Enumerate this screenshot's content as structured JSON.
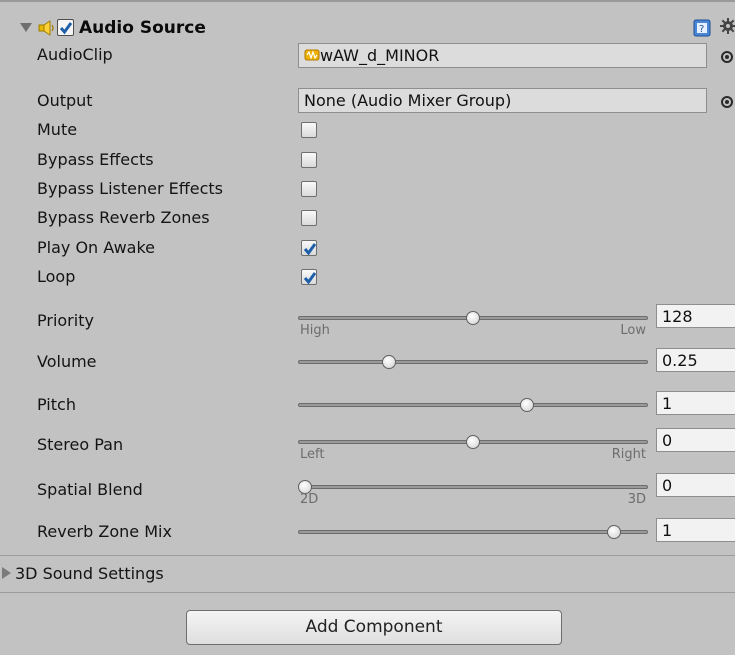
{
  "component": {
    "title": "Audio Source",
    "enabled": true,
    "icons": {
      "fold": "triangle-down-icon",
      "type": "speaker-icon",
      "help": "help-book-icon",
      "settings": "gear-icon"
    }
  },
  "fields": {
    "audioclip": {
      "label": "AudioClip",
      "value": "wAW_d_MINOR",
      "icon": "audio-clip-icon"
    },
    "output": {
      "label": "Output",
      "value": "None (Audio Mixer Group)"
    }
  },
  "toggles": [
    {
      "label": "Mute",
      "checked": false
    },
    {
      "label": "Bypass Effects",
      "checked": false
    },
    {
      "label": "Bypass Listener Effects",
      "checked": false
    },
    {
      "label": "Bypass Reverb Zones",
      "checked": false
    },
    {
      "label": "Play On Awake",
      "checked": true
    },
    {
      "label": "Loop",
      "checked": true
    }
  ],
  "sliders": [
    {
      "key": "priority",
      "label": "Priority",
      "value": "128",
      "level": 0.5,
      "left": "High",
      "right": "Low"
    },
    {
      "key": "volume",
      "label": "Volume",
      "value": "0.25",
      "level": 0.25
    },
    {
      "key": "pitch",
      "label": "Pitch",
      "value": "1",
      "level": 0.66
    },
    {
      "key": "stereo_pan",
      "label": "Stereo Pan",
      "value": "0",
      "level": 0.5,
      "left": "Left",
      "right": "Right"
    },
    {
      "key": "spatial_blend",
      "label": "Spatial Blend",
      "value": "0",
      "level": 0.0,
      "left": "2D",
      "right": "3D"
    },
    {
      "key": "reverb_zone_mix",
      "label": "Reverb Zone Mix",
      "value": "1",
      "level": 0.92
    }
  ],
  "sound3d": {
    "label": "3D Sound Settings"
  },
  "add_component_label": "Add Component",
  "colors": {
    "accent": "#1f5fa8",
    "clip_icon": "#e0a000",
    "panel": "#c2c2c2"
  }
}
